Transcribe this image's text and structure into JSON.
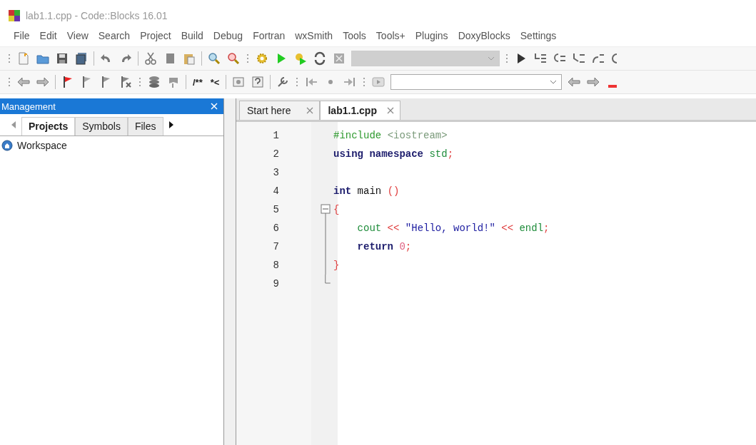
{
  "window": {
    "title": "lab1.1.cpp - Code::Blocks 16.01"
  },
  "menu": [
    "File",
    "Edit",
    "View",
    "Search",
    "Project",
    "Build",
    "Debug",
    "Fortran",
    "wxSmith",
    "Tools",
    "Tools+",
    "Plugins",
    "DoxyBlocks",
    "Settings"
  ],
  "toolbar_1": {
    "dropdown": {
      "disabled": true
    }
  },
  "toolbar_2": {
    "doxy_buttons": [
      "/**",
      "*<"
    ],
    "dropdown": {
      "disabled": false
    }
  },
  "management": {
    "title": "Management",
    "tabs": [
      {
        "label": "Projects",
        "selected": true
      },
      {
        "label": "Symbols",
        "selected": false
      },
      {
        "label": "Files",
        "selected": false
      }
    ],
    "tree": [
      {
        "label": "Workspace"
      }
    ]
  },
  "editor": {
    "tabs": [
      {
        "label": "Start here",
        "selected": false
      },
      {
        "label": "lab1.1.cpp",
        "selected": true
      }
    ],
    "lines": [
      {
        "number": "1",
        "tokens": [
          {
            "kind": "preprocessor",
            "text": "#include "
          },
          {
            "kind": "include",
            "text": "<iostream>"
          }
        ]
      },
      {
        "number": "2",
        "tokens": [
          {
            "kind": "keyword",
            "text": "using namespace "
          },
          {
            "kind": "identifier",
            "text": "std"
          },
          {
            "kind": "operator",
            "text": ";"
          }
        ]
      },
      {
        "number": "3"
      },
      {
        "number": "4",
        "tokens": [
          {
            "kind": "keyword",
            "text": "int "
          },
          {
            "kind": "plain",
            "text": "main "
          },
          {
            "kind": "operator",
            "text": "()"
          }
        ]
      },
      {
        "number": "5",
        "kind": "fold_start",
        "tokens": [
          {
            "kind": "operator",
            "text": "{"
          }
        ]
      },
      {
        "number": "6",
        "kind": "fold_body",
        "indented": true,
        "tokens": [
          {
            "kind": "identifier",
            "text": "cout "
          },
          {
            "kind": "operator",
            "text": "<< "
          },
          {
            "kind": "string",
            "text": "\"Hello, world!\" "
          },
          {
            "kind": "operator",
            "text": "<< "
          },
          {
            "kind": "identifier",
            "text": "endl"
          },
          {
            "kind": "operator",
            "text": ";"
          }
        ]
      },
      {
        "number": "7",
        "kind": "fold_body",
        "indented": true,
        "tokens": [
          {
            "kind": "keyword",
            "text": "return "
          },
          {
            "kind": "number",
            "text": "0"
          },
          {
            "kind": "operator",
            "text": ";"
          }
        ]
      },
      {
        "number": "8",
        "kind": "fold_body",
        "tokens": [
          {
            "kind": "operator",
            "text": "}"
          }
        ]
      },
      {
        "number": "9",
        "kind": "fold_end"
      }
    ]
  }
}
